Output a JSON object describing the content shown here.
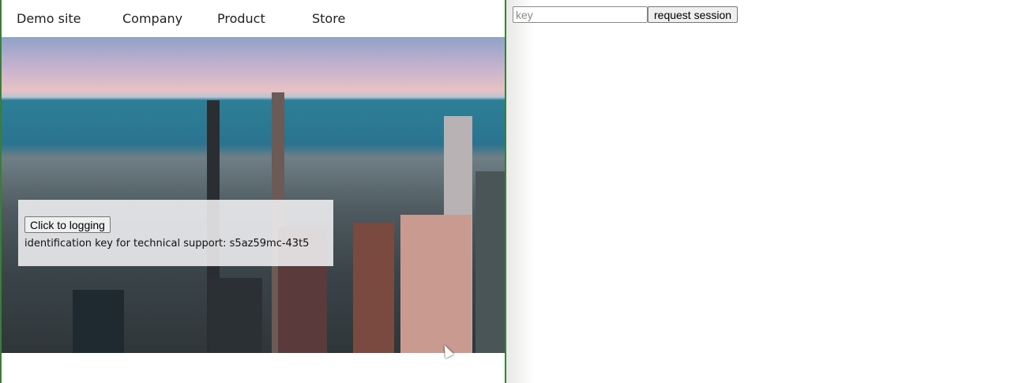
{
  "nav": {
    "items": [
      "Demo site",
      "Company",
      "Product",
      "Store"
    ]
  },
  "hero": {
    "login_button": "Click to logging",
    "support_text": "identification key for technical support: s5az59mc-43t5"
  },
  "session": {
    "key_placeholder": "key",
    "request_button": "request session"
  }
}
